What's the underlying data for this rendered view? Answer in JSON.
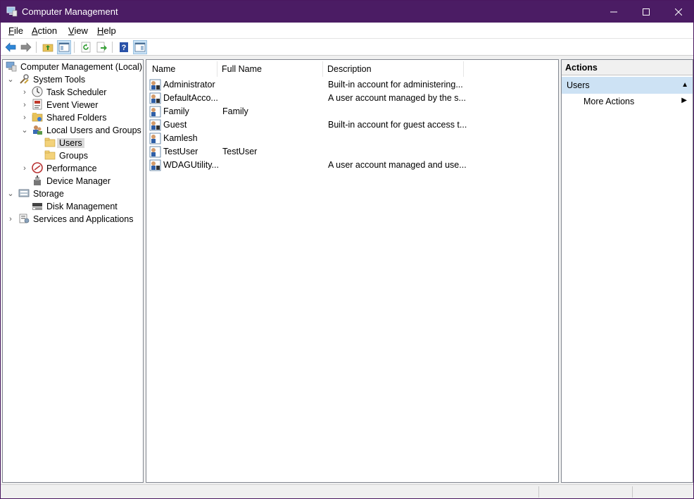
{
  "window": {
    "title": "Computer Management"
  },
  "menu": [
    {
      "label": "File",
      "key": "F",
      "rest": "ile"
    },
    {
      "label": "Action",
      "key": "A",
      "rest": "ction"
    },
    {
      "label": "View",
      "key": "V",
      "rest": "iew"
    },
    {
      "label": "Help",
      "key": "H",
      "rest": "elp"
    }
  ],
  "toolbar": {
    "buttons": [
      "back-icon",
      "forward-icon",
      "up-folder-icon",
      "show-hide-console-tree-icon",
      "refresh-icon",
      "export-list-icon",
      "help-icon",
      "show-hide-action-pane-icon"
    ]
  },
  "tree": {
    "root": "Computer Management (Local)",
    "system_tools": "System Tools",
    "task_scheduler": "Task Scheduler",
    "event_viewer": "Event Viewer",
    "shared_folders": "Shared Folders",
    "local_users_groups": "Local Users and Groups",
    "users": "Users",
    "groups": "Groups",
    "performance": "Performance",
    "device_manager": "Device Manager",
    "storage": "Storage",
    "disk_management": "Disk Management",
    "services_apps": "Services and Applications"
  },
  "list": {
    "columns": {
      "name": "Name",
      "full_name": "Full Name",
      "description": "Description"
    },
    "rows": [
      {
        "name": "Administrator",
        "full_name": "",
        "description": "Built-in account for administering..."
      },
      {
        "name": "DefaultAcco...",
        "full_name": "",
        "description": "A user account managed by the s..."
      },
      {
        "name": "Family",
        "full_name": "Family",
        "description": ""
      },
      {
        "name": "Guest",
        "full_name": "",
        "description": "Built-in account for guest access t..."
      },
      {
        "name": "Kamlesh",
        "full_name": "",
        "description": ""
      },
      {
        "name": "TestUser",
        "full_name": "TestUser",
        "description": ""
      },
      {
        "name": "WDAGUtility...",
        "full_name": "",
        "description": "A user account managed and use..."
      }
    ]
  },
  "actions": {
    "header": "Actions",
    "section": "Users",
    "more_actions": "More Actions"
  },
  "colors": {
    "titlebar": "#4b1c64",
    "selection": "#cde2f4"
  }
}
